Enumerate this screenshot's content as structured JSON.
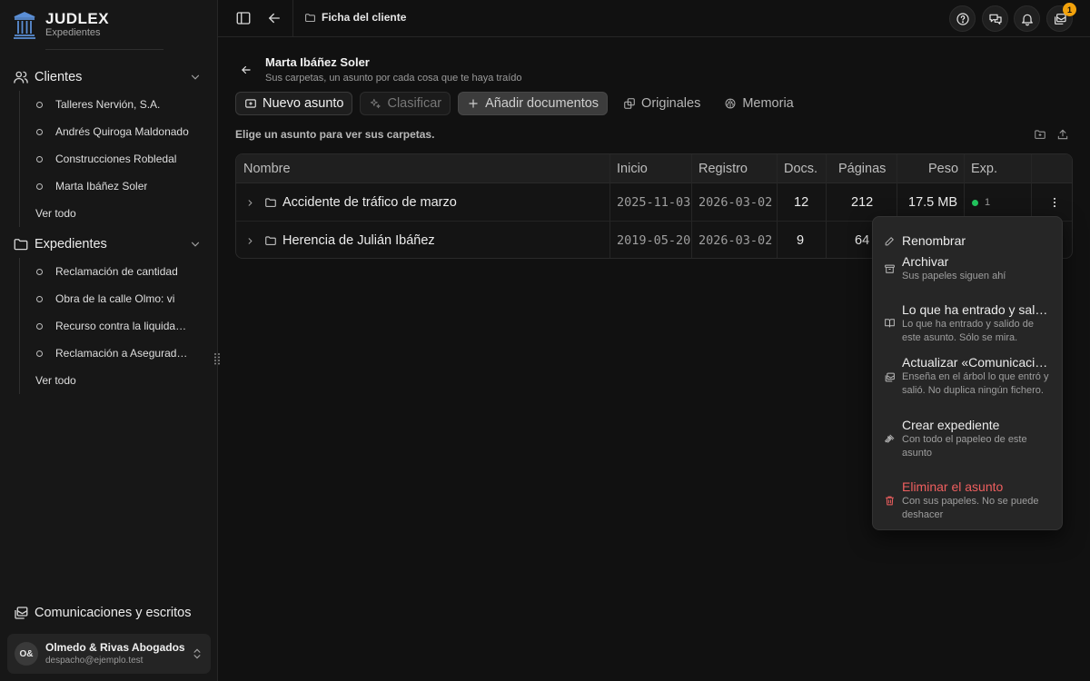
{
  "brand": {
    "name": "JUDLEX",
    "subtitle": "Expedientes"
  },
  "sidebar": {
    "clients": {
      "label": "Clientes",
      "items": [
        "Talleres Nervión, S.A.",
        "Andrés Quiroga Maldonado",
        "Construcciones Robledal",
        "Marta Ibáñez Soler"
      ],
      "more": "Ver todo"
    },
    "cases": {
      "label": "Expedientes",
      "items": [
        "Reclamación de cantidad",
        "Obra de la calle Olmo: vi",
        "Recurso contra la liquidación",
        "Reclamación a Aseguradora"
      ],
      "more": "Ver todo"
    },
    "comms": "Comunicaciones y escritos",
    "account": {
      "initials": "O&",
      "name": "Olmedo & Rivas Abogados",
      "email": "despacho@ejemplo.test"
    }
  },
  "topbar": {
    "breadcrumb": "Ficha del cliente",
    "badge_count": "1"
  },
  "client": {
    "name": "Marta Ibáñez Soler",
    "subtitle": "Sus carpetas, un asunto por cada cosa que te haya traído"
  },
  "actions": {
    "new": "Nuevo asunto",
    "classify": "Clasificar",
    "add_docs": "Añadir documentos",
    "originals": "Originales",
    "memory": "Memoria"
  },
  "hint": "Elige un asunto para ver sus carpetas.",
  "table": {
    "headers": {
      "name": "Nombre",
      "start": "Inicio",
      "registry": "Registro",
      "docs": "Docs.",
      "pages": "Páginas",
      "weight": "Peso",
      "exp": "Exp."
    },
    "rows": [
      {
        "name": "Accidente de tráfico de marzo",
        "start": "2025-11-03",
        "registry": "2026-03-02",
        "docs": "12",
        "pages": "212",
        "weight": "17.5 MB",
        "exp": "1"
      },
      {
        "name": "Herencia de Julián Ibáñez",
        "start": "2019-05-20",
        "registry": "2026-03-02",
        "docs": "9",
        "pages": "64"
      }
    ]
  },
  "menu": {
    "rename": "Renombrar",
    "archive": {
      "title": "Archivar",
      "desc": "Sus papeles siguen ahí"
    },
    "inout": {
      "title": "Lo que ha entrado y salido",
      "desc": "Lo que ha entrado y salido de este asunto. Sólo se mira."
    },
    "update": {
      "title": "Actualizar «Comunicaciones»",
      "desc": "Enseña en el árbol lo que entró y salió. No duplica ningún fichero."
    },
    "create": {
      "title": "Crear expediente",
      "desc": "Con todo el papeleo de este asunto"
    },
    "delete": {
      "title": "Eliminar el asunto",
      "desc": "Con sus papeles. No se puede deshacer"
    }
  },
  "colors": {
    "background": "#111111",
    "sidebar": "#171717",
    "accent_logo": "#5b8fd6",
    "badge": "#f2a20c",
    "status_ok": "#22c55e",
    "danger": "#ef5f5f"
  }
}
